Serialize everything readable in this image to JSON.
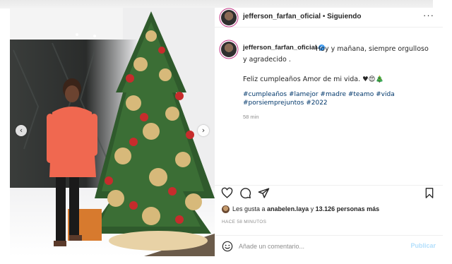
{
  "header": {
    "username": "jefferson_farfan_oficial",
    "separator": "•",
    "follow_state": "Siguiendo",
    "more_label": "···"
  },
  "caption": {
    "username": "jefferson_farfan_oficial",
    "verified_mark": "✓",
    "line1": "Hoy y mañana, siempre orgulloso y agradecido .",
    "line2": "Feliz cumpleaños Amor de mi vida. ♥😍🎄",
    "hashtags": "#cumpleaños #lamejor #madre #teamo #vida #porsiemprejuntos #2022",
    "time": "58 min"
  },
  "icons": {
    "like": "heart-icon",
    "comment": "comment-icon",
    "share": "share-icon",
    "save": "bookmark-icon",
    "emoji": "smiley-icon",
    "prev": "chevron-left-icon",
    "next": "chevron-right-icon"
  },
  "carousel": {
    "prev": "‹",
    "next": "›"
  },
  "likes": {
    "prefix": "Les gusta a ",
    "user": "anabelen.laya",
    "middle": " y ",
    "count": "13.126 personas más"
  },
  "timestamp": "HACE 58 MINUTOS",
  "comment": {
    "placeholder": "Añade un comentario...",
    "publish_label": "Publicar"
  },
  "colors": {
    "link": "#00376b",
    "verified": "#3897f0",
    "publish_disabled": "#b2dffc",
    "muted": "#8e8e8e"
  }
}
